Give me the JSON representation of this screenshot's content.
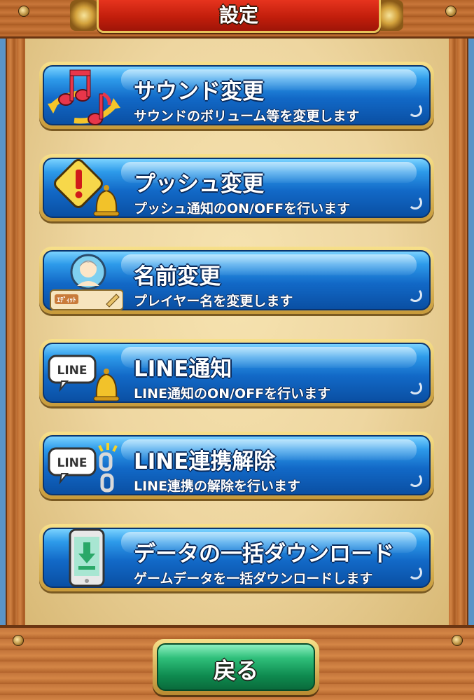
{
  "header": {
    "title": "設定"
  },
  "menu": {
    "items": [
      {
        "title": "サウンド変更",
        "desc": "サウンドのボリューム等を変更します",
        "icon": "music-notes-icon"
      },
      {
        "title": "プッシュ変更",
        "desc": "プッシュ通知のON/OFFを行います",
        "icon": "warning-bell-icon"
      },
      {
        "title": "名前変更",
        "desc": "プレイヤー名を変更します",
        "icon": "avatar-nameplate-icon",
        "icon_label": "ｴﾃﾞｨｯﾄ"
      },
      {
        "title": "LINE通知",
        "desc": "LINE通知のON/OFFを行います",
        "icon": "line-bell-icon",
        "icon_label": "LINE"
      },
      {
        "title": "LINE連携解除",
        "desc": "LINE連携の解除を行います",
        "icon": "line-unlink-icon",
        "icon_label": "LINE"
      },
      {
        "title": "データの一括ダウンロード",
        "desc": "ゲームデータを一括ダウンロードします",
        "icon": "phone-download-icon"
      }
    ]
  },
  "footer": {
    "back_label": "戻る"
  },
  "colors": {
    "button_blue": "#1269c7",
    "back_green": "#2fbf7a",
    "title_red": "#c01d0b",
    "parchment": "#eed6a0"
  }
}
